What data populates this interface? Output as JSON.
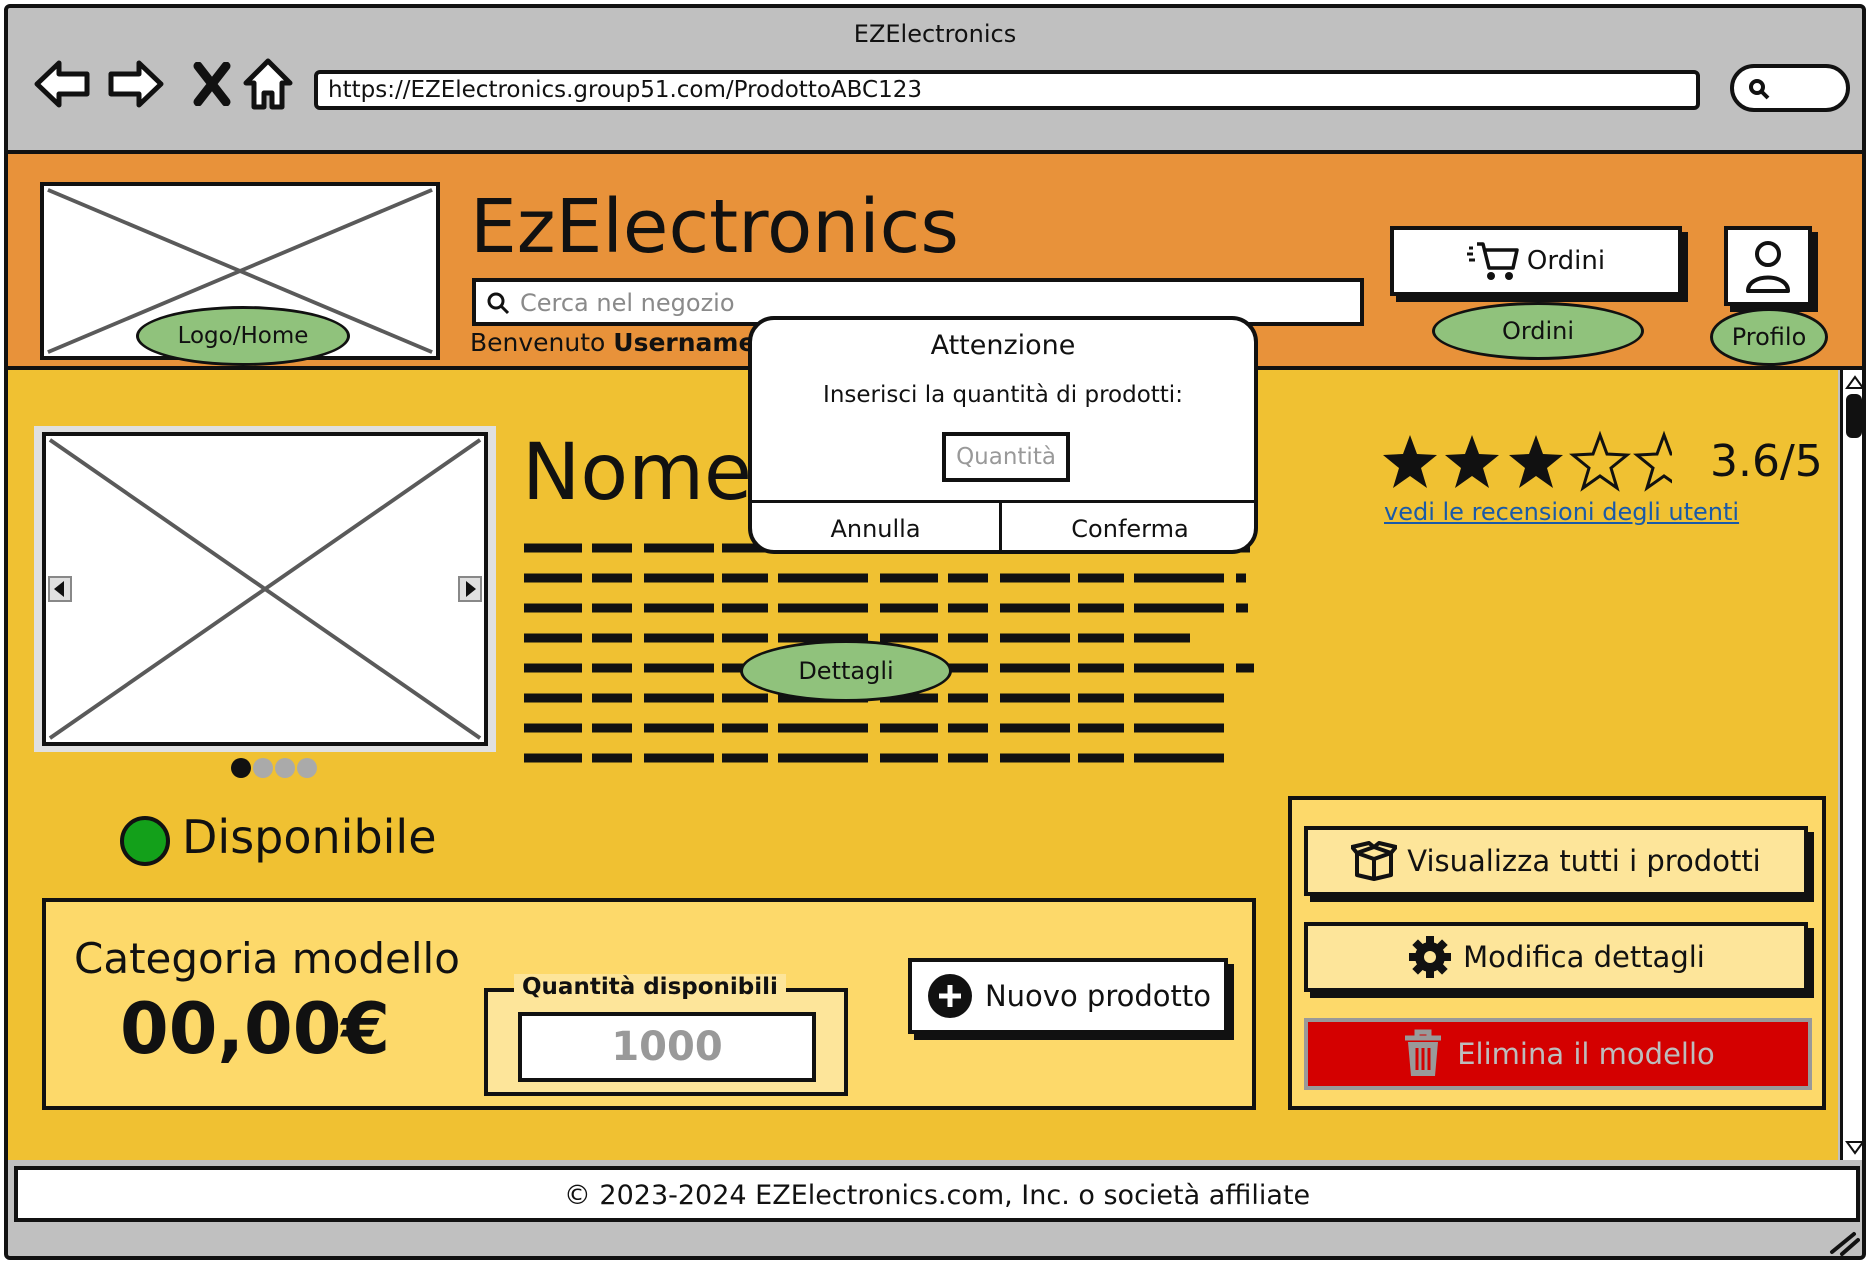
{
  "window": {
    "title": "EZElectronics"
  },
  "browser": {
    "url": "https://EZElectronics.group51.com/ProdottoABC123"
  },
  "header": {
    "logo_label": "Logo/Home",
    "brand": "EzElectronics",
    "search_placeholder": "Cerca nel negozio",
    "welcome_prefix": "Benvenuto",
    "username": "Username",
    "orders_button": "Ordini",
    "orders_label": "Ordini",
    "profile_label": "Profilo"
  },
  "dialog": {
    "title": "Attenzione",
    "message": "Inserisci la quantità di prodotti:",
    "quantity_placeholder": "Quantità",
    "cancel": "Annulla",
    "confirm": "Conferma"
  },
  "product": {
    "name": "Nome",
    "details_label": "Dettagli",
    "availability": "Disponibile",
    "category": "Categoria modello",
    "price": "00,00€",
    "carousel": {
      "slides": 4,
      "active": 1
    }
  },
  "rating": {
    "value": 3.6,
    "text": "3.6/5",
    "stars_total": 5,
    "reviews_link": "vedi le recensioni degli utenti"
  },
  "stock": {
    "label": "Quantità disponibili",
    "value": "1000"
  },
  "actions": {
    "new_product": "Nuovo prodotto",
    "view_all": "Visualizza tutti i prodotti",
    "edit_details": "Modifica dettagli",
    "delete_model": "Elimina il modello"
  },
  "footer": {
    "text": "© 2023-2024 EZElectronics.com, Inc. o società affiliate"
  },
  "colors": {
    "header_bg": "#e8923a",
    "main_bg": "#f0c132",
    "panel_bg": "#fdd96a",
    "label_green": "#90c27c",
    "available_green": "#13a01a",
    "delete_red": "#d40000",
    "link_blue": "#1a5aa8"
  },
  "icons": [
    "back-arrow-icon",
    "forward-arrow-icon",
    "close-icon",
    "home-icon",
    "search-icon",
    "cart-icon",
    "user-icon",
    "star-icon",
    "box-icon",
    "gear-icon",
    "trash-icon",
    "plus-circle-icon",
    "resize-grip-icon"
  ]
}
